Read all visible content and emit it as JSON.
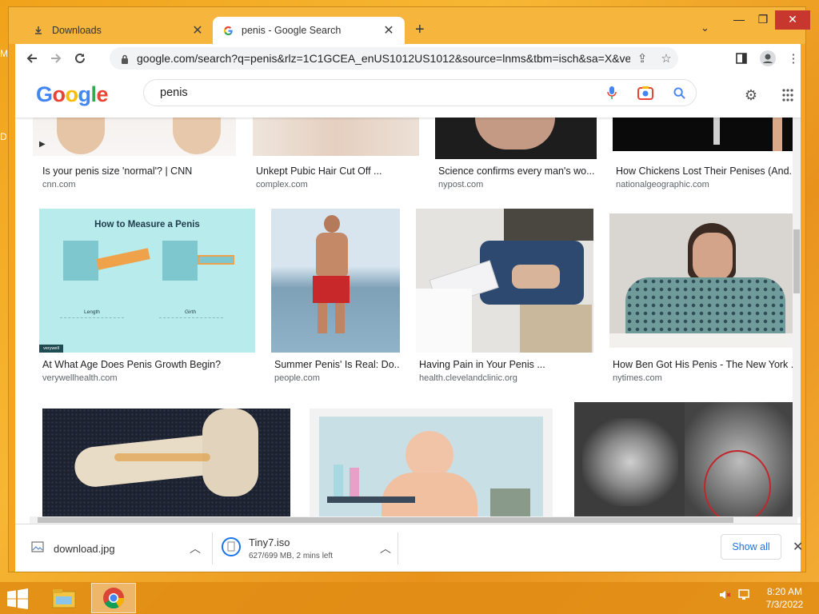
{
  "browser": {
    "tabs": [
      {
        "label": "Downloads",
        "icon": "download-icon"
      },
      {
        "label": "penis - Google Search",
        "icon": "google-g-icon"
      }
    ],
    "url": "google.com/search?q=penis&rlz=1C1GCEA_enUS1012US1012&source=lnms&tbm=isch&sa=X&ved=2ah..."
  },
  "google": {
    "logo_letters": [
      {
        "ch": "G",
        "color": "#4285F4"
      },
      {
        "ch": "o",
        "color": "#EA4335"
      },
      {
        "ch": "o",
        "color": "#FBBC05"
      },
      {
        "ch": "g",
        "color": "#4285F4"
      },
      {
        "ch": "l",
        "color": "#34A853"
      },
      {
        "ch": "e",
        "color": "#EA4335"
      }
    ],
    "query": "penis"
  },
  "results_row1": [
    {
      "title": "Is your penis size 'normal'? | CNN",
      "source": "cnn.com"
    },
    {
      "title": "Unkept Pubic Hair Cut Off ...",
      "source": "complex.com"
    },
    {
      "title": "Science confirms every man's wo...",
      "source": "nypost.com"
    },
    {
      "title": "How Chickens Lost Their Penises (And...",
      "source": "nationalgeographic.com"
    }
  ],
  "results_row2": [
    {
      "title": "At What Age Does Penis Growth Begin?",
      "source": "verywellhealth.com",
      "image_text": "How to Measure a Penis",
      "sub_labels": [
        "Length",
        "Girth"
      ],
      "brand": "verywell"
    },
    {
      "title": "Summer Penis' Is Real: Do...",
      "source": "people.com"
    },
    {
      "title": "Having Pain in Your Penis ...",
      "source": "health.clevelandclinic.org"
    },
    {
      "title": "How Ben Got His Penis - The New York ...",
      "source": "nytimes.com"
    }
  ],
  "downloads": [
    {
      "name": "download.jpg"
    },
    {
      "name": "Tiny7.iso",
      "status": "627/699 MB, 2 mins left"
    }
  ],
  "download_bar": {
    "show_all": "Show all"
  },
  "taskbar": {
    "time": "8:20 AM",
    "date": "7/3/2022"
  }
}
